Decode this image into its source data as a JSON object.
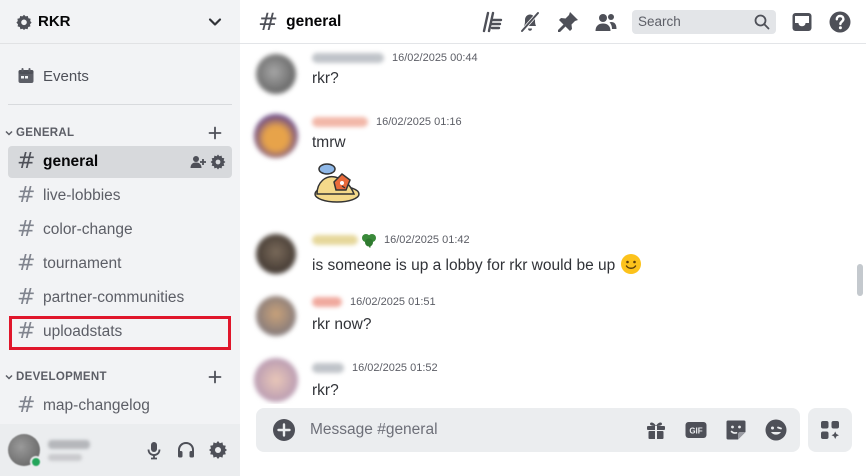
{
  "server": {
    "name": "RKR"
  },
  "sidebar": {
    "events_label": "Events",
    "categories": [
      {
        "label": "GENERAL"
      },
      {
        "label": "DEVELOPMENT"
      }
    ],
    "channels": [
      {
        "label": "general"
      },
      {
        "label": "live-lobbies"
      },
      {
        "label": "color-change"
      },
      {
        "label": "tournament"
      },
      {
        "label": "partner-communities"
      },
      {
        "label": "uploadstats"
      },
      {
        "label": "map-changelog"
      }
    ]
  },
  "channel": {
    "hash": "#",
    "title": "general"
  },
  "search": {
    "placeholder": "Search"
  },
  "messages": [
    {
      "time": "16/02/2025 00:44",
      "text": "rkr?"
    },
    {
      "time": "16/02/2025 01:16",
      "text": "tmrw"
    },
    {
      "time": "16/02/2025 01:42",
      "text": "is someone is up a lobby for rkr would be up"
    },
    {
      "time": "16/02/2025 01:51",
      "text": "rkr now?"
    },
    {
      "time": "16/02/2025 01:52",
      "text": "rkr?"
    }
  ],
  "composer": {
    "placeholder": "Message #general",
    "gif_label": "GIF"
  },
  "colors": {
    "accent_highlight": "#e0162b",
    "online": "#23a55a",
    "sidebar_bg": "#f2f3f5"
  }
}
